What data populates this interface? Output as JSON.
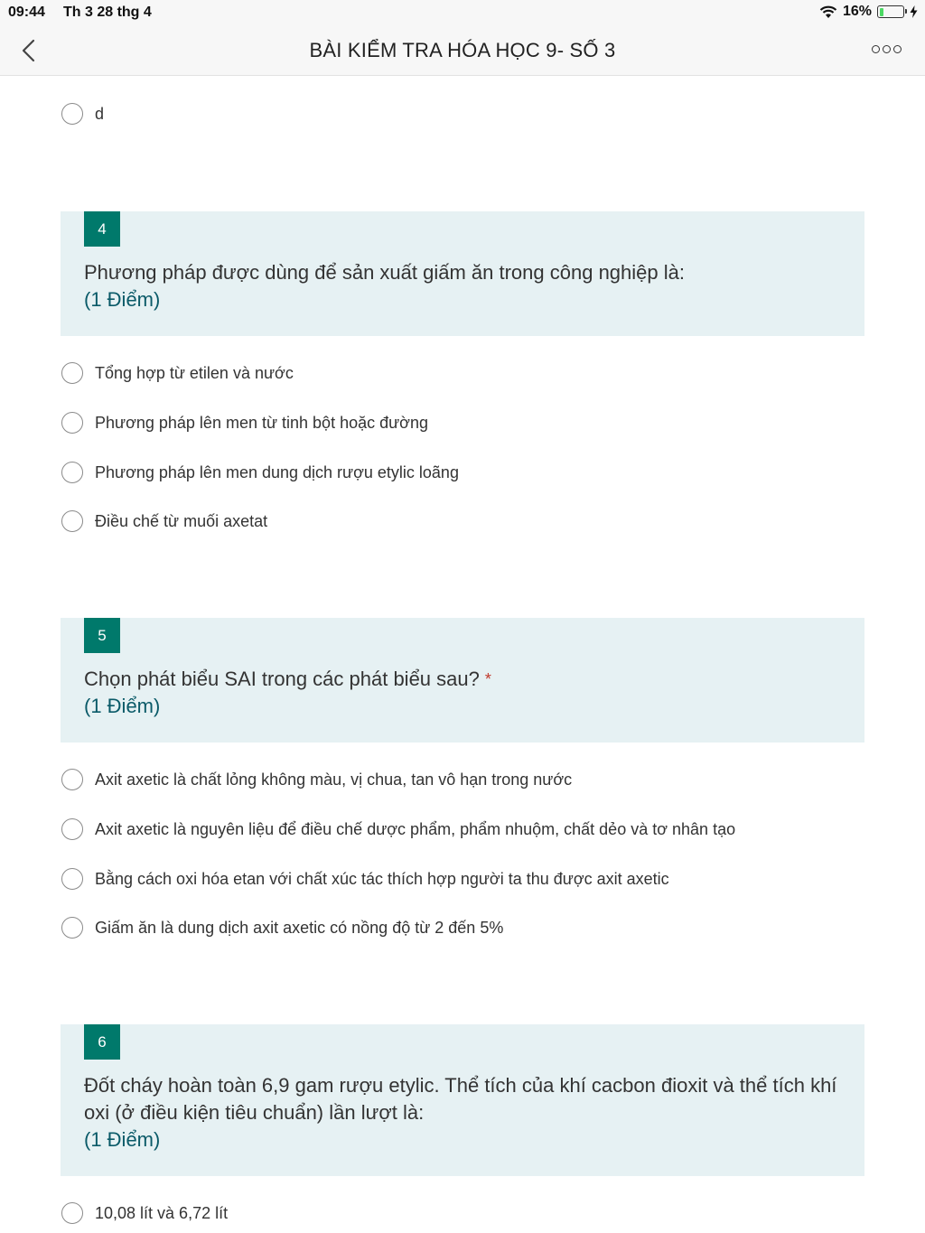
{
  "status": {
    "time": "09:44",
    "date": "Th 3 28 thg 4",
    "battery": "16%"
  },
  "nav": {
    "title": "BÀI KIỂM TRA HÓA HỌC 9- SỐ 3"
  },
  "prev_option": {
    "label": "d"
  },
  "questions": [
    {
      "number": "4",
      "text": "Phương pháp được dùng để sản xuất giấm ăn trong công nghiệp là:",
      "required": "",
      "points": "(1 Điểm)",
      "options": [
        "Tổng hợp từ etilen và nước",
        "Phương pháp lên men từ tinh bột hoặc đường",
        "Phương pháp lên men dung dịch rượu etylic loãng",
        "Điều chế từ muối axetat"
      ]
    },
    {
      "number": "5",
      "text": "Chọn phát biểu SAI trong các phát biểu sau?",
      "required": "*",
      "points": "(1 Điểm)",
      "options": [
        "Axit axetic là chất lỏng không màu, vị chua, tan vô hạn trong nước",
        "Axit axetic là nguyên liệu để điều chế dược phẩm, phẩm nhuộm, chất dẻo và tơ nhân tạo",
        "Bằng cách oxi hóa etan với chất xúc tác thích hợp người ta thu được axit axetic",
        "Giấm ăn là dung dịch axit axetic có nồng độ từ 2 đến 5%"
      ]
    },
    {
      "number": "6",
      "text": "Đốt cháy hoàn toàn 6,9 gam rượu etylic. Thể tích của khí cacbon đioxit và thể tích khí oxi (ở điều kiện tiêu chuẩn) lần lượt là:",
      "required": "",
      "points": "(1 Điểm)",
      "options": [
        "10,08 lít và 6,72 lít"
      ]
    }
  ],
  "colors": {
    "accent": "#00796b",
    "card_bg": "#e6f1f3",
    "points": "#0a5a68",
    "required": "#c0392b",
    "battery_fill": "#4cd964"
  },
  "icons": {
    "back": "chevron-left-icon",
    "more": "more-icon",
    "wifi": "wifi-icon",
    "battery": "battery-icon",
    "charging": "bolt-icon"
  }
}
